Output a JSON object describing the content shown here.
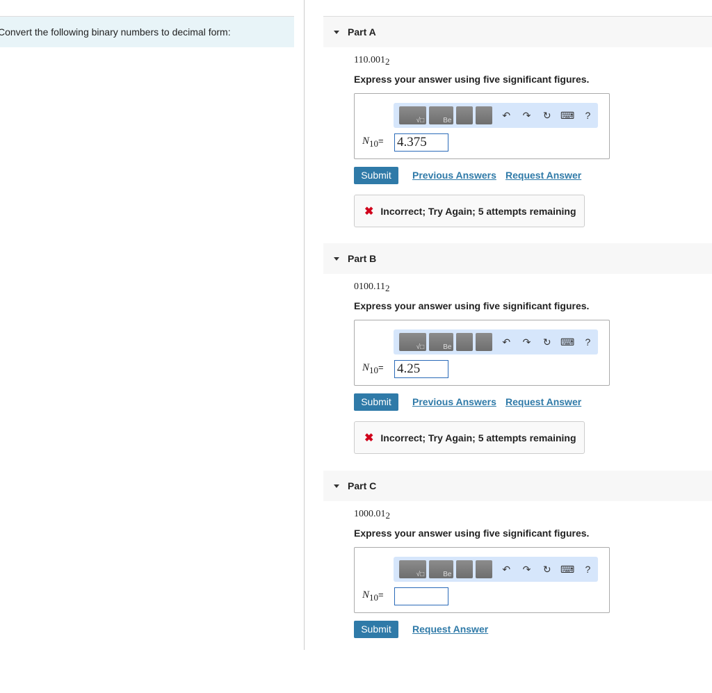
{
  "prompt": "Convert the following binary numbers to decimal form:",
  "parts": [
    {
      "title": "Part A",
      "binary": "110.001",
      "base": "2",
      "instruction": "Express your answer using five significant figures.",
      "label_n": "N",
      "label_sub": "10",
      "label_eq": "=",
      "value": "4.375",
      "submit": "Submit",
      "previous": "Previous Answers",
      "request": "Request Answer",
      "feedback": "Incorrect; Try Again; 5 attempts remaining"
    },
    {
      "title": "Part B",
      "binary": "0100.11",
      "base": "2",
      "instruction": "Express your answer using five significant figures.",
      "label_n": "N",
      "label_sub": "10",
      "label_eq": "=",
      "value": "4.25",
      "submit": "Submit",
      "previous": "Previous Answers",
      "request": "Request Answer",
      "feedback": "Incorrect; Try Again; 5 attempts remaining"
    },
    {
      "title": "Part C",
      "binary": "1000.01",
      "base": "2",
      "instruction": "Express your answer using five significant figures.",
      "label_n": "N",
      "label_sub": "10",
      "label_eq": "=",
      "value": "",
      "submit": "Submit",
      "request": "Request Answer"
    }
  ],
  "toolbar": {
    "templates": "√□",
    "greek": "Be",
    "undo": "↶",
    "redo": "↷",
    "reset": "↻",
    "keyboard": "⌨",
    "help": "?"
  }
}
